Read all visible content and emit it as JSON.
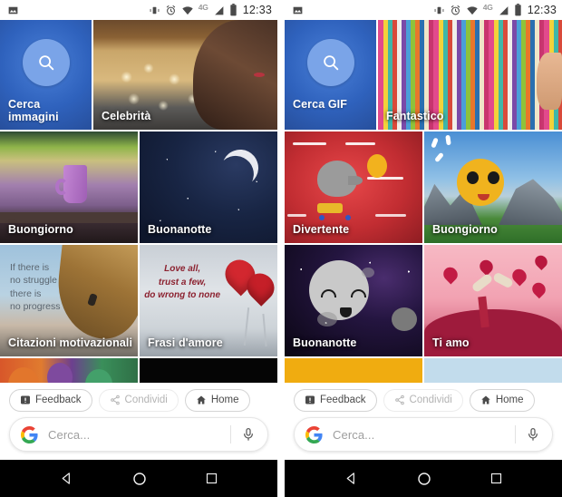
{
  "statusbar": {
    "time": "12:33",
    "network_label": "4G",
    "icons": [
      "photo-icon",
      "vibrate-icon",
      "alarm-icon",
      "wifi-icon",
      "signal-icon",
      "battery-icon"
    ]
  },
  "panels": [
    {
      "id": "images-panel",
      "rows": [
        {
          "tiles": [
            {
              "label": "Cerca\nimmagini",
              "kind": "search",
              "name": "tile-search-images"
            },
            {
              "label": "Celebrità",
              "kind": "celebrity",
              "name": "tile-celebrita"
            }
          ]
        },
        {
          "tiles": [
            {
              "label": "Buongiorno",
              "kind": "mug",
              "name": "tile-buongiorno"
            },
            {
              "label": "Buonanotte",
              "kind": "moon-night",
              "name": "tile-buonanotte"
            }
          ]
        },
        {
          "tiles": [
            {
              "label": "Citazioni motivazionali",
              "kind": "climber",
              "name": "tile-citazioni-motivazionali",
              "quote": "If there is\nno struggle\nthere is\nno progress"
            },
            {
              "label": "Frasi d'amore",
              "kind": "hearts",
              "name": "tile-frasi-damore",
              "quote": "Love all,\ntrust a few,\ndo wrong to none"
            }
          ]
        },
        {
          "tiles": [
            {
              "label": "",
              "kind": "balloons",
              "name": "tile-partial-balloons"
            },
            {
              "label": "",
              "kind": "fireworks",
              "name": "tile-partial-fireworks"
            }
          ]
        }
      ],
      "chips": [
        {
          "label": "Feedback",
          "icon": "feedback-icon",
          "muted": false
        },
        {
          "label": "Condividi",
          "icon": "share-icon",
          "muted": true
        },
        {
          "label": "Home",
          "icon": "home-icon",
          "muted": false
        }
      ],
      "search": {
        "placeholder": "Cerca...",
        "logo": "google-g-icon",
        "mic": "microphone-icon"
      },
      "nav": {
        "back": "back-triangle-icon",
        "home": "home-circle-icon",
        "recents": "recents-square-icon"
      }
    },
    {
      "id": "gif-panel",
      "rows": [
        {
          "tiles": [
            {
              "label": "Cerca GIF",
              "kind": "search",
              "name": "tile-search-gif"
            },
            {
              "label": "Fantastico",
              "kind": "stripes",
              "name": "tile-fantastico"
            }
          ]
        },
        {
          "tiles": [
            {
              "label": "Divertente",
              "kind": "elephant",
              "name": "tile-divertente"
            },
            {
              "label": "Buongiorno",
              "kind": "sun",
              "name": "tile-buongiorno-gif"
            }
          ]
        },
        {
          "tiles": [
            {
              "label": "Buonanotte",
              "kind": "sleepy-moon",
              "name": "tile-buonanotte-gif"
            },
            {
              "label": "Ti amo",
              "kind": "love-toss",
              "name": "tile-ti-amo"
            }
          ]
        },
        {
          "tiles": [
            {
              "label": "",
              "kind": "yellow-partial",
              "name": "tile-partial-yellow"
            },
            {
              "label": "",
              "kind": "blue-partial",
              "name": "tile-partial-blue"
            }
          ]
        }
      ],
      "chips": [
        {
          "label": "Feedback",
          "icon": "feedback-icon",
          "muted": false
        },
        {
          "label": "Condividi",
          "icon": "share-icon",
          "muted": true
        },
        {
          "label": "Home",
          "icon": "home-icon",
          "muted": false
        }
      ],
      "search": {
        "placeholder": "Cerca...",
        "logo": "google-g-icon",
        "mic": "microphone-icon"
      },
      "nav": {
        "back": "back-triangle-icon",
        "home": "home-circle-icon",
        "recents": "recents-square-icon"
      }
    }
  ],
  "colors": {
    "search_tile_blue": "#2f62bd",
    "search_circle_blue": "#7aa4e8",
    "chip_border": "#d4d4d4",
    "chip_muted_text": "#b4b4b4",
    "navbar_black": "#000000",
    "google_blue": "#4285F4",
    "google_red": "#EA4335",
    "google_yellow": "#FBBC05",
    "google_green": "#34A853"
  }
}
